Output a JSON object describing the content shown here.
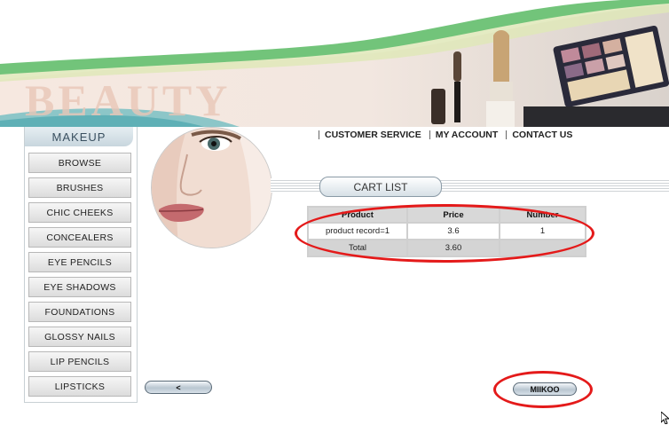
{
  "banner": {
    "watermark": "BEAUTY"
  },
  "sidebar": {
    "title": "MAKEUP",
    "items": [
      {
        "label": "BROWSE"
      },
      {
        "label": "BRUSHES"
      },
      {
        "label": "CHIC CHEEKS"
      },
      {
        "label": "CONCEALERS"
      },
      {
        "label": "EYE PENCILS"
      },
      {
        "label": "EYE SHADOWS"
      },
      {
        "label": "FOUNDATIONS"
      },
      {
        "label": "GLOSSY NAILS"
      },
      {
        "label": "LIP PENCILS"
      },
      {
        "label": "LIPSTICKS"
      }
    ]
  },
  "topnav": {
    "customer_service": "CUSTOMER SERVICE",
    "my_account": "MY ACCOUNT",
    "contact_us": "CONTACT US"
  },
  "cart": {
    "title": "CART LIST",
    "headers": {
      "product": "Product",
      "price": "Price",
      "number": "Number"
    },
    "rows": [
      {
        "product": "product record=1",
        "price": "3.6",
        "number": "1"
      }
    ],
    "total": {
      "label": "Total",
      "value": "3.60"
    }
  },
  "buttons": {
    "back": "<",
    "action": "MIIKOO"
  },
  "colors": {
    "annotation": "#e41a1a",
    "nav_green": "#72c47a",
    "teal": "#8cc6c8"
  }
}
